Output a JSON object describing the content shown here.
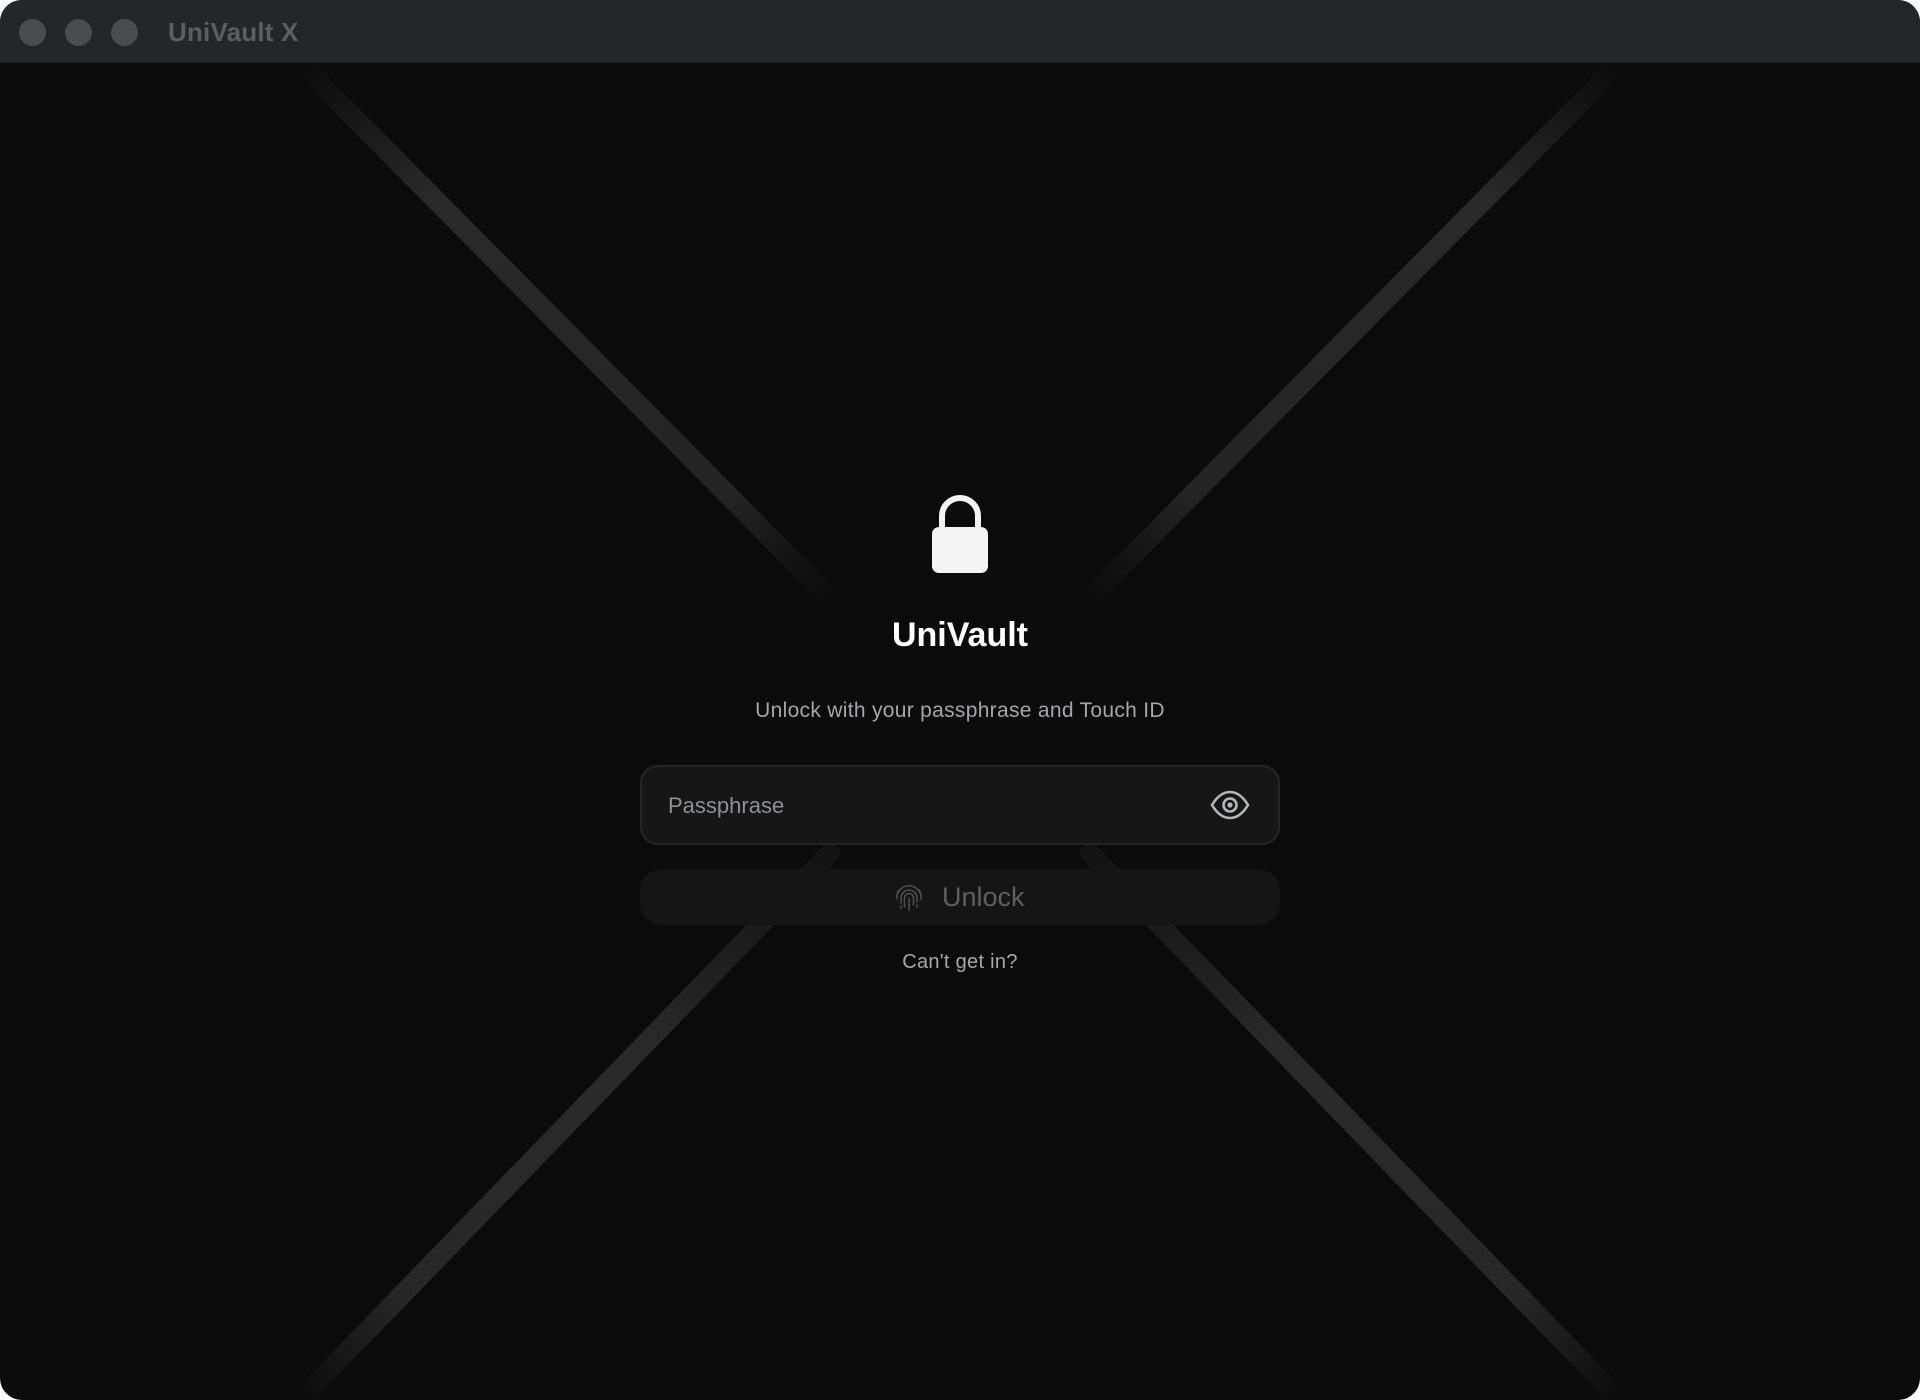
{
  "window": {
    "title": "UniVault X"
  },
  "lock_screen": {
    "icon": "lock-icon",
    "app_name": "UniVault",
    "subtitle": "Unlock with your passphrase and Touch ID",
    "passphrase": {
      "value": "",
      "placeholder": "Passphrase",
      "toggle_icon": "eye-icon"
    },
    "unlock_button": {
      "icon": "fingerprint-icon",
      "label": "Unlock"
    },
    "help_link": "Can't get in?"
  },
  "colors": {
    "background": "#0b0b0b",
    "titlebar": "#24272a",
    "traffic_light": "#4a4c4f",
    "field_background": "#161616",
    "field_border": "#262626",
    "primary_text": "#ffffff",
    "secondary_text": "#a4a6a8",
    "disabled_text": "#5d5f61"
  }
}
